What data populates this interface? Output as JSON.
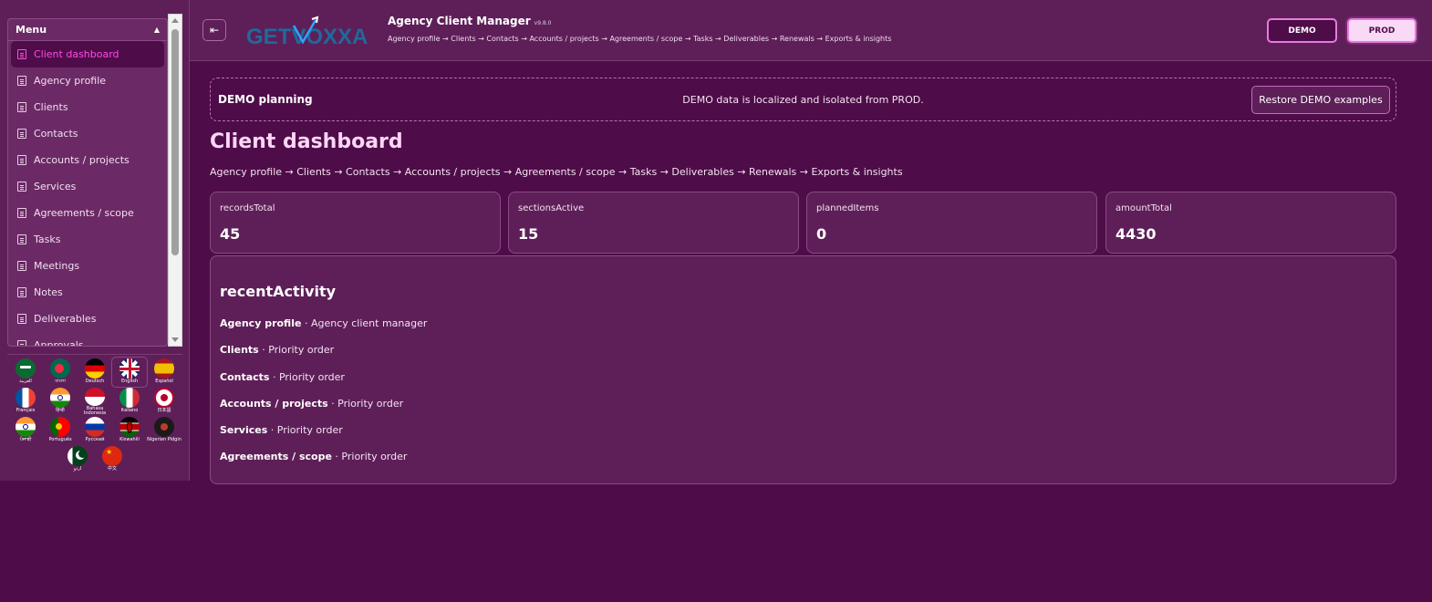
{
  "sidebar": {
    "menu_title": "Menu",
    "items": [
      {
        "label": "Client dashboard",
        "active": true
      },
      {
        "label": "Agency profile"
      },
      {
        "label": "Clients"
      },
      {
        "label": "Contacts"
      },
      {
        "label": "Accounts / projects"
      },
      {
        "label": "Services"
      },
      {
        "label": "Agreements / scope"
      },
      {
        "label": "Tasks"
      },
      {
        "label": "Meetings"
      },
      {
        "label": "Notes"
      },
      {
        "label": "Deliverables"
      },
      {
        "label": "Approvals"
      }
    ],
    "languages": [
      {
        "label": "العربية",
        "icon": "flag-saudi-arabia-icon"
      },
      {
        "label": "বাংলা",
        "icon": "flag-bangladesh-icon"
      },
      {
        "label": "Deutsch",
        "icon": "flag-germany-icon"
      },
      {
        "label": "English",
        "icon": "flag-uk-icon",
        "selected": true
      },
      {
        "label": "Español",
        "icon": "flag-spain-icon"
      },
      {
        "label": "Français",
        "icon": "flag-france-icon"
      },
      {
        "label": "हिन्दी",
        "icon": "flag-india-icon"
      },
      {
        "label": "Bahasa Indonesia",
        "icon": "flag-indonesia-icon"
      },
      {
        "label": "Italiano",
        "icon": "flag-italy-icon"
      },
      {
        "label": "日本語",
        "icon": "flag-japan-icon"
      },
      {
        "label": "ਪੰਜਾਬੀ",
        "icon": "flag-india-icon"
      },
      {
        "label": "Português",
        "icon": "flag-portugal-icon"
      },
      {
        "label": "Русский",
        "icon": "flag-russia-icon"
      },
      {
        "label": "Kiswahili",
        "icon": "flag-kenya-icon"
      },
      {
        "label": "Nigerian Pidgin",
        "icon": "flag-nigerian-pidgin-icon"
      },
      {
        "label": "اردو",
        "icon": "flag-pakistan-icon"
      },
      {
        "label": "中文",
        "icon": "flag-china-icon"
      }
    ]
  },
  "header": {
    "logo_text": "GETVOXXA",
    "app_title": "Agency Client Manager",
    "version": "v9.8.0",
    "breadcrumb": "Agency profile → Clients → Contacts → Accounts / projects → Agreements / scope → Tasks → Deliverables → Renewals → Exports & insights",
    "demo_label": "DEMO",
    "prod_label": "PROD"
  },
  "banner": {
    "title": "DEMO planning",
    "message": "DEMO data is localized and isolated from PROD.",
    "restore_label": "Restore DEMO examples"
  },
  "main": {
    "title": "Client dashboard",
    "breadcrumb": "Agency profile → Clients → Contacts → Accounts / projects → Agreements / scope → Tasks → Deliverables → Renewals → Exports & insights",
    "stats": [
      {
        "key": "recordsTotal",
        "value": "45"
      },
      {
        "key": "sectionsActive",
        "value": "15"
      },
      {
        "key": "plannedItems",
        "value": "0"
      },
      {
        "key": "amountTotal",
        "value": "4430"
      }
    ],
    "activity_title": "recentActivity",
    "activity": [
      {
        "section": "Agency profile",
        "detail": " · Agency client manager"
      },
      {
        "section": "Clients",
        "detail": " · Priority order"
      },
      {
        "section": "Contacts",
        "detail": " · Priority order"
      },
      {
        "section": "Accounts / projects",
        "detail": " · Priority order"
      },
      {
        "section": "Services",
        "detail": " · Priority order"
      },
      {
        "section": "Agreements / scope",
        "detail": " · Priority order"
      }
    ]
  },
  "colors": {
    "background": "#4e0c48",
    "panel": "#5e1f58",
    "accent": "#ff4be6",
    "title_pink": "#fbd6f6"
  }
}
